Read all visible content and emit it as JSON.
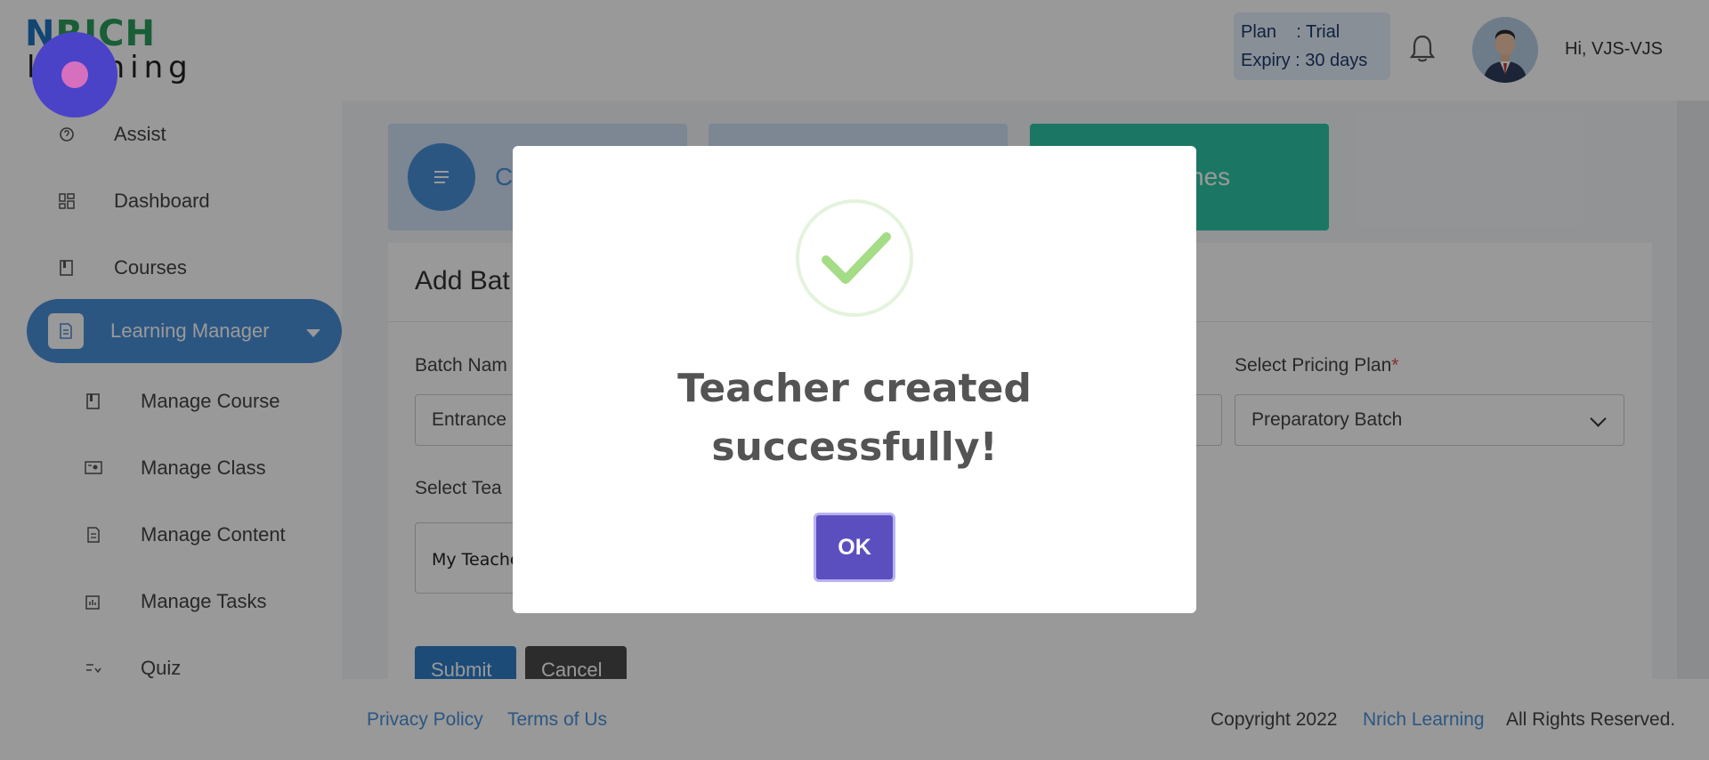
{
  "header": {
    "logo_top_n": "N",
    "logo_top_rest": "RICH",
    "logo_bottom": "learning",
    "plan_line": "Plan    : Trial",
    "expiry_line": "Expiry : 30 days",
    "greeting": "Hi, VJS-VJS"
  },
  "sidebar": {
    "items": [
      {
        "label": "Assist",
        "icon": "assist-icon"
      },
      {
        "label": "Dashboard",
        "icon": "dashboard-icon"
      },
      {
        "label": "Courses",
        "icon": "book-icon"
      },
      {
        "label": "Learning Manager",
        "icon": "document-icon",
        "active": true
      },
      {
        "label": "Manage Course",
        "icon": "book-icon"
      },
      {
        "label": "Manage Class",
        "icon": "class-icon"
      },
      {
        "label": "Manage Content",
        "icon": "content-icon"
      },
      {
        "label": "Manage Tasks",
        "icon": "tasks-icon"
      },
      {
        "label": "Quiz",
        "icon": "quiz-icon"
      }
    ]
  },
  "cards": {
    "card1_label": "C",
    "card3_label": "nes"
  },
  "form": {
    "title": "Add Bat",
    "batch_name_label": "Batch Nam",
    "batch_name_value": "Entrance",
    "pricing_label": "Select Pricing Plan",
    "required_mark": "*",
    "pricing_value": "Preparatory Batch",
    "teacher_label": "Select Tea",
    "teacher_value": "My Teache",
    "submit": "Submit",
    "cancel": "Cancel"
  },
  "footer": {
    "privacy": "Privacy Policy",
    "terms": "Terms of Us",
    "copyright": "Copyright 2022",
    "brand": "Nrich Learning",
    "rights": "All Rights Reserved."
  },
  "modal": {
    "title_line1": "Teacher created",
    "title_line2": "successfully!",
    "ok": "OK",
    "success_color": "#a5dc86"
  }
}
